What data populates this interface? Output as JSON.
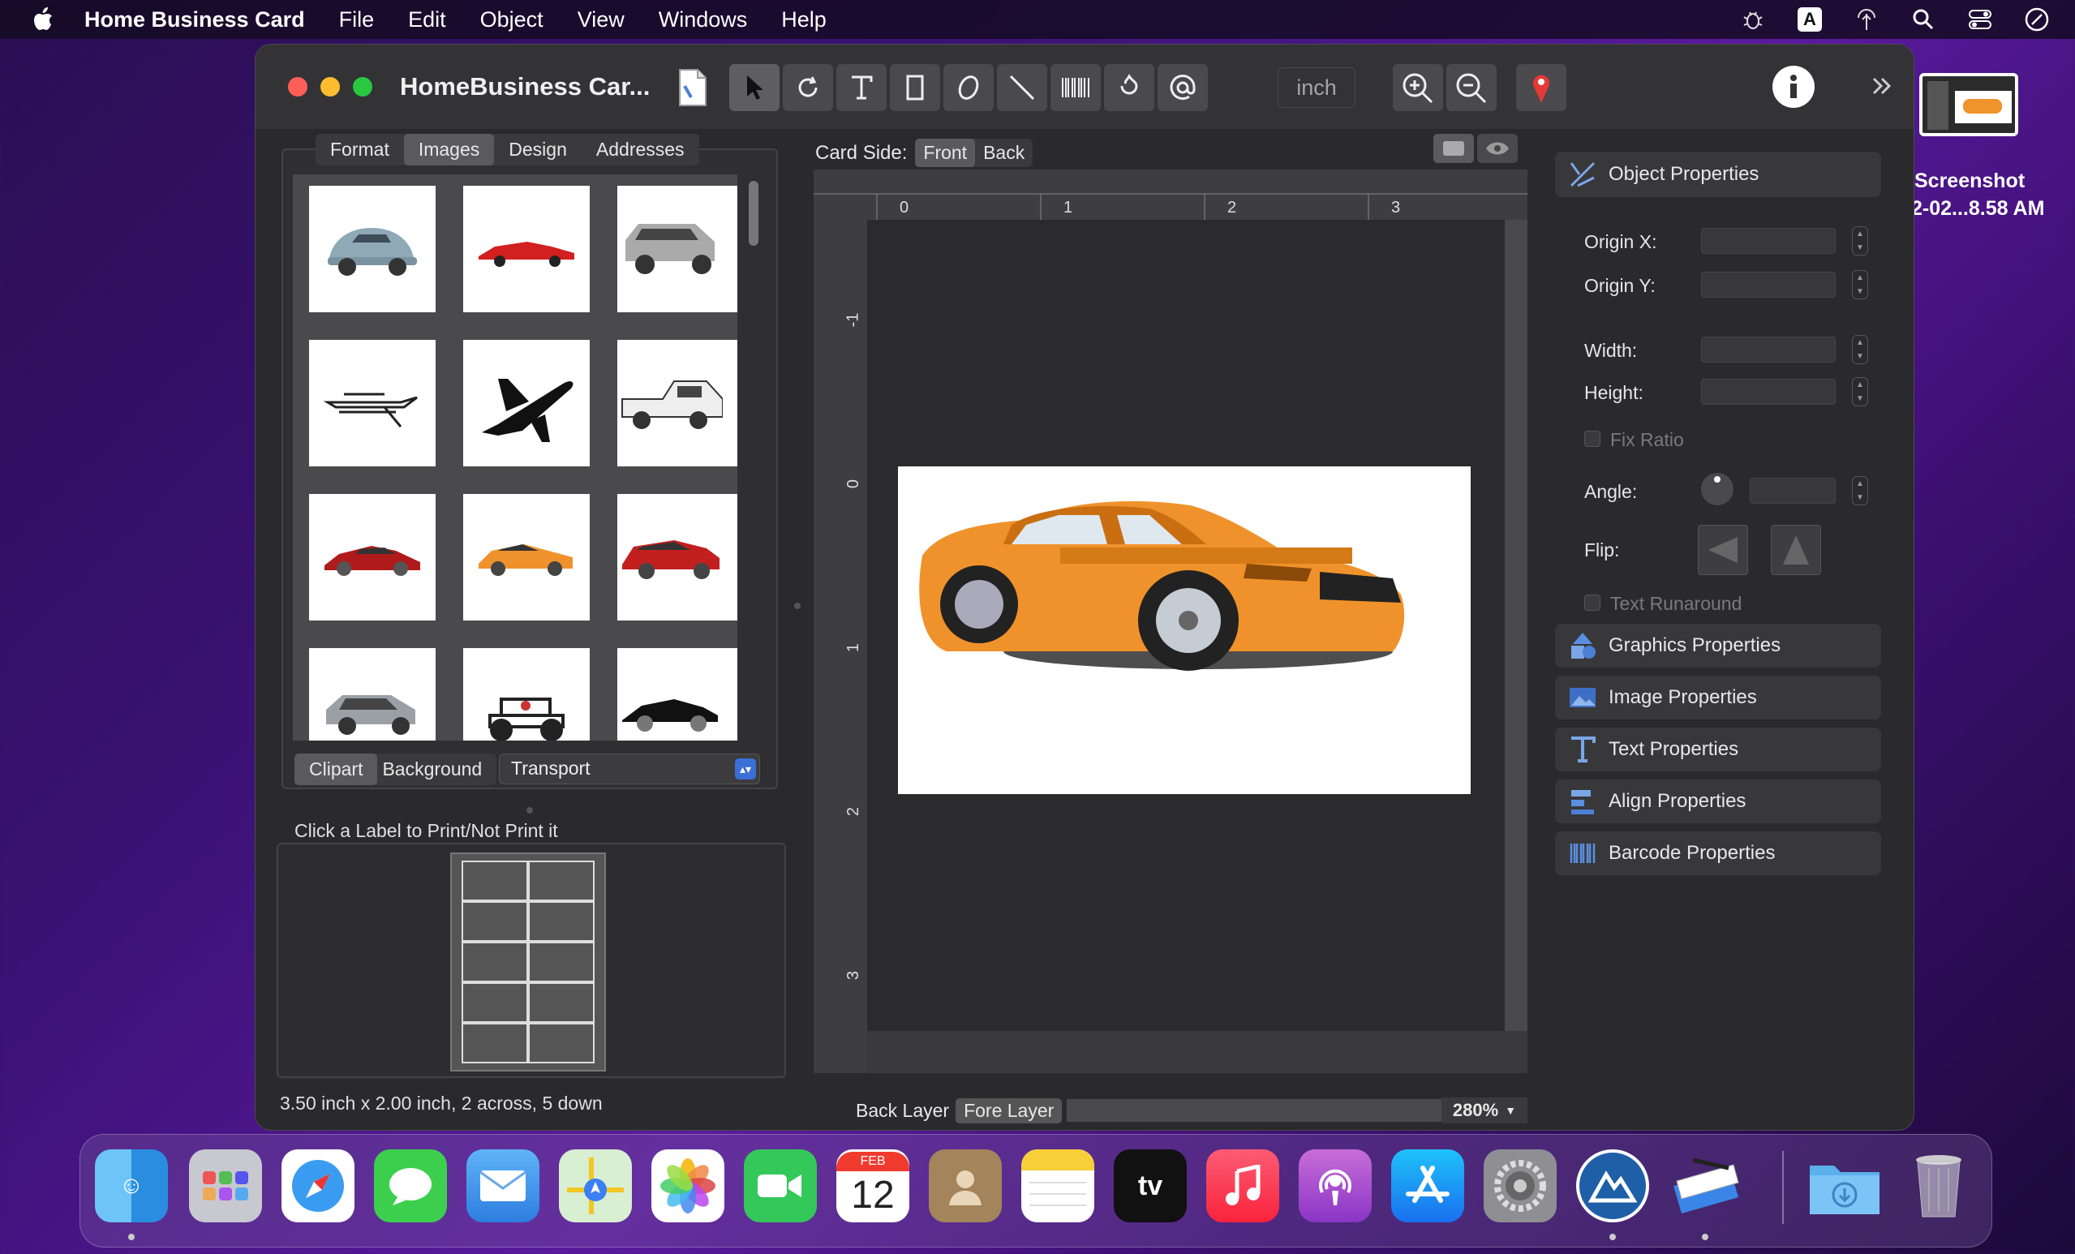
{
  "menubar": {
    "app_name": "Home Business Card",
    "items": [
      "File",
      "Edit",
      "Object",
      "View",
      "Windows",
      "Help"
    ]
  },
  "desktop": {
    "file_label_line1": "Screenshot",
    "file_label_line2": "2-02...8.58 AM"
  },
  "window": {
    "title": "HomeBusiness Car...",
    "unit": "inch",
    "tools": [
      "select-tool",
      "rotate-tool",
      "text-tool",
      "rectangle-tool",
      "ellipse-tool",
      "line-tool",
      "barcode-tool",
      "fill-tool",
      "email-tool"
    ]
  },
  "left_panel": {
    "tabs": [
      "Format",
      "Images",
      "Design",
      "Addresses"
    ],
    "active_tab": "Images",
    "source_tabs": [
      "Clipart",
      "Background"
    ],
    "active_source": "Clipart",
    "category": "Transport",
    "thumbnails": [
      "vw-beetle",
      "red-sports-car",
      "silver-suv",
      "speedboat",
      "airplane",
      "pickup-truck",
      "red-ferrari",
      "orange-mustang",
      "red-muscle-car",
      "silver-bmw-suv",
      "jeep",
      "black-porsche"
    ],
    "print_hint": "Click a Label to Print/Not Print it",
    "status": "3.50 inch x 2.00 inch, 2 across, 5 down"
  },
  "canvas": {
    "card_side_label": "Card Side:",
    "sides": [
      "Front",
      "Back"
    ],
    "active_side": "Front",
    "ruler_h": [
      "0",
      "1",
      "2",
      "3"
    ],
    "ruler_v": [
      "-1",
      "0",
      "1",
      "2",
      "3"
    ],
    "layers": [
      "Back Layer",
      "Fore Layer"
    ],
    "active_layer": "Fore Layer",
    "zoom": "280%"
  },
  "properties": {
    "object_header": "Object Properties",
    "origin_x": "Origin X:",
    "origin_y": "Origin Y:",
    "width": "Width:",
    "height": "Height:",
    "fix_ratio": "Fix Ratio",
    "angle": "Angle:",
    "flip": "Flip:",
    "text_runaround": "Text Runaround",
    "sections": [
      "Graphics Properties",
      "Image Properties",
      "Text Properties",
      "Align Properties",
      "Barcode Properties"
    ]
  },
  "dock": {
    "calendar_month": "FEB",
    "calendar_day": "12",
    "apps": [
      "finder",
      "launchpad",
      "safari",
      "messages",
      "mail",
      "maps",
      "photos",
      "facetime",
      "calendar",
      "contacts",
      "notes",
      "tv",
      "music",
      "podcasts",
      "app-store",
      "system-preferences",
      "altair",
      "home-business-card",
      "downloads",
      "trash"
    ]
  }
}
